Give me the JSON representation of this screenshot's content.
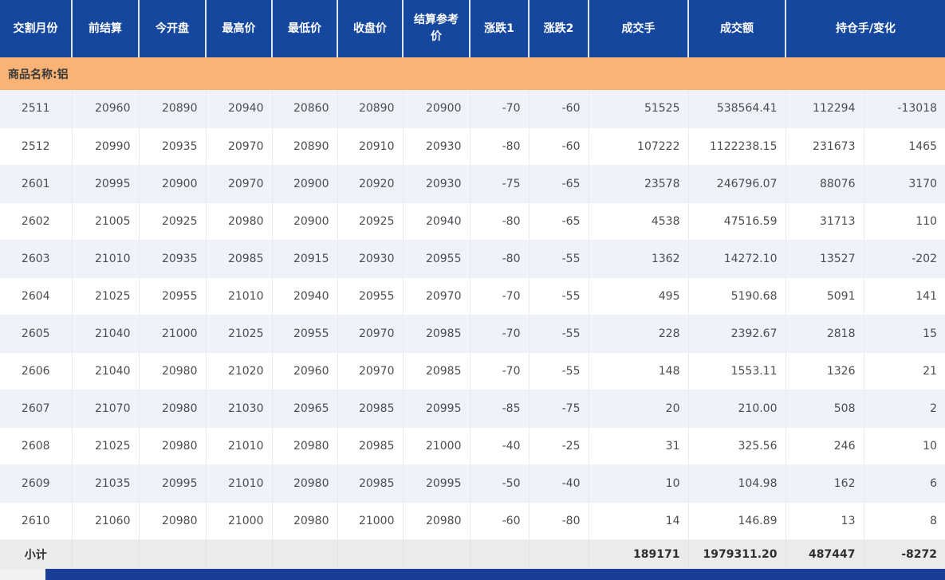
{
  "table": {
    "group_label": "商品名称:铝",
    "columns": [
      {
        "key": "delivery_month",
        "label": "交割月份"
      },
      {
        "key": "prev_settlement",
        "label": "前结算"
      },
      {
        "key": "open",
        "label": "今开盘"
      },
      {
        "key": "high",
        "label": "最高价"
      },
      {
        "key": "low",
        "label": "最低价"
      },
      {
        "key": "close",
        "label": "收盘价"
      },
      {
        "key": "settlement_ref",
        "label": "结算参考价"
      },
      {
        "key": "change1",
        "label": "涨跌1"
      },
      {
        "key": "change2",
        "label": "涨跌2"
      },
      {
        "key": "volume",
        "label": "成交手"
      },
      {
        "key": "turnover",
        "label": "成交额"
      },
      {
        "key": "open_interest_change",
        "label": "持仓手/变化"
      }
    ],
    "cell_keys": [
      "delivery_month",
      "prev_settlement",
      "open",
      "high",
      "low",
      "close",
      "settlement_ref",
      "change1",
      "change2",
      "volume",
      "turnover",
      "open_interest",
      "oi_change"
    ],
    "rows": [
      [
        "2511",
        "20960",
        "20890",
        "20940",
        "20860",
        "20890",
        "20900",
        "-70",
        "-60",
        "51525",
        "538564.41",
        "112294",
        "-13018"
      ],
      [
        "2512",
        "20990",
        "20935",
        "20970",
        "20890",
        "20910",
        "20930",
        "-80",
        "-60",
        "107222",
        "1122238.15",
        "231673",
        "1465"
      ],
      [
        "2601",
        "20995",
        "20900",
        "20970",
        "20900",
        "20920",
        "20930",
        "-75",
        "-65",
        "23578",
        "246796.07",
        "88076",
        "3170"
      ],
      [
        "2602",
        "21005",
        "20925",
        "20980",
        "20900",
        "20925",
        "20940",
        "-80",
        "-65",
        "4538",
        "47516.59",
        "31713",
        "110"
      ],
      [
        "2603",
        "21010",
        "20935",
        "20985",
        "20915",
        "20930",
        "20955",
        "-80",
        "-55",
        "1362",
        "14272.10",
        "13527",
        "-202"
      ],
      [
        "2604",
        "21025",
        "20955",
        "21010",
        "20940",
        "20955",
        "20970",
        "-70",
        "-55",
        "495",
        "5190.68",
        "5091",
        "141"
      ],
      [
        "2605",
        "21040",
        "21000",
        "21025",
        "20955",
        "20970",
        "20985",
        "-70",
        "-55",
        "228",
        "2392.67",
        "2818",
        "15"
      ],
      [
        "2606",
        "21040",
        "20980",
        "21020",
        "20960",
        "20970",
        "20985",
        "-70",
        "-55",
        "148",
        "1553.11",
        "1326",
        "21"
      ],
      [
        "2607",
        "21070",
        "20980",
        "21030",
        "20965",
        "20985",
        "20995",
        "-85",
        "-75",
        "20",
        "210.00",
        "508",
        "2"
      ],
      [
        "2608",
        "21025",
        "20980",
        "21010",
        "20980",
        "20985",
        "21000",
        "-40",
        "-25",
        "31",
        "325.56",
        "246",
        "10"
      ],
      [
        "2609",
        "21035",
        "20995",
        "21010",
        "20980",
        "20985",
        "20995",
        "-50",
        "-40",
        "10",
        "104.98",
        "162",
        "6"
      ],
      [
        "2610",
        "21060",
        "20980",
        "21000",
        "20980",
        "21000",
        "20980",
        "-60",
        "-80",
        "14",
        "146.89",
        "13",
        "8"
      ]
    ],
    "subtotal": {
      "label": "小计",
      "volume": "189171",
      "turnover": "1979311.20",
      "open_interest": "487447",
      "oi_change": "-8272"
    }
  },
  "colors": {
    "header_bg": "#15479E",
    "header_text": "#FFFFFF",
    "group_row_bg": "#F9B376",
    "row_alt_bg": "#EFF2F9",
    "row_bg": "#FFFFFF",
    "subtotal_bg": "#EBEBEB",
    "scrollbar_thumb": "#1A3E96"
  }
}
